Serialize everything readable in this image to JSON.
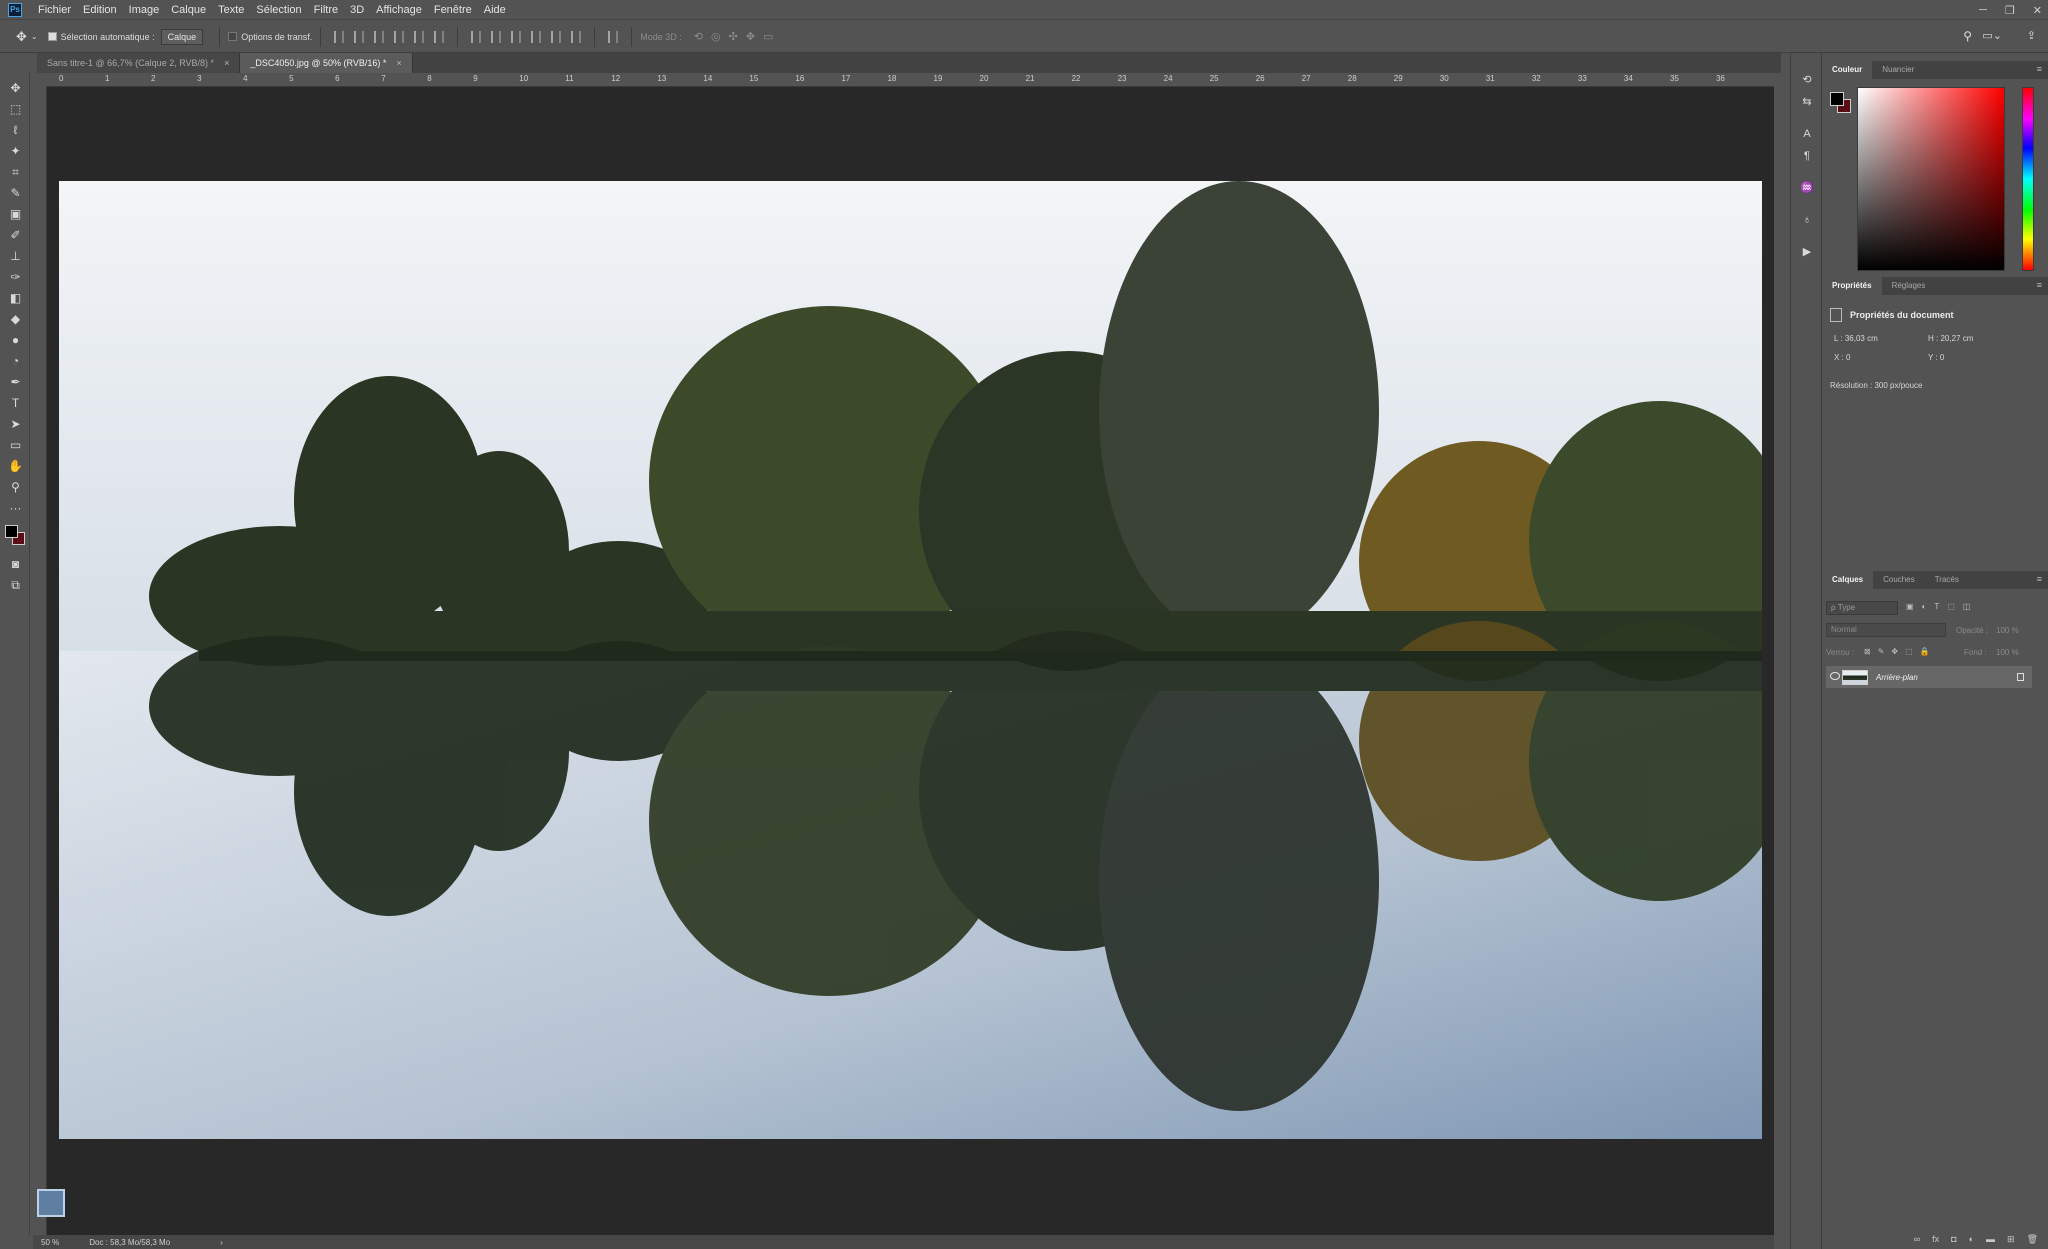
{
  "app": {
    "logo": "Ps"
  },
  "menu": [
    "Fichier",
    "Edition",
    "Image",
    "Calque",
    "Texte",
    "Sélection",
    "Filtre",
    "3D",
    "Affichage",
    "Fenêtre",
    "Aide"
  ],
  "options": {
    "auto_select_label": "Sélection automatique :",
    "auto_select_value": "Calque",
    "transform_label": "Options de transf.",
    "mode3d_label": "Mode 3D :"
  },
  "tabs": [
    {
      "label": "Sans titre-1 @ 66,7% (Calque 2, RVB/8) *",
      "close": "×"
    },
    {
      "label": "_DSC4050.jpg @ 50% (RVB/16) *",
      "close": "×"
    }
  ],
  "ruler": {
    "h_ticks": [
      "0",
      "1",
      "2",
      "3",
      "4",
      "5",
      "6",
      "7",
      "8",
      "9",
      "10",
      "11",
      "12",
      "13",
      "14",
      "15",
      "16",
      "17",
      "18",
      "19",
      "20",
      "21",
      "22",
      "23",
      "24",
      "25",
      "26",
      "27",
      "28",
      "29",
      "30",
      "31",
      "32",
      "33",
      "34",
      "35",
      "36"
    ]
  },
  "status": {
    "zoom": "50 %",
    "doc": "Doc : 58,3 Mo/58,3 Mo",
    "arrow": "›"
  },
  "color_panel": {
    "tabs": [
      "Couleur",
      "Nuancier"
    ],
    "fg": "#000000",
    "bg": "#5a0d14",
    "menu": "≡"
  },
  "properties_panel": {
    "tabs": [
      "Propriétés",
      "Réglages"
    ],
    "menu": "≡",
    "header": "Propriétés du document",
    "L": "L :  36,03 cm",
    "H": "H :  20,27 cm",
    "X": "X :  0",
    "Y": "Y :  0",
    "resolution": "Résolution : 300 px/pouce"
  },
  "layers_panel": {
    "tabs": [
      "Calques",
      "Couches",
      "Tracés"
    ],
    "menu": "≡",
    "search_placeholder": "ρ Type",
    "blend_mode": "Normal",
    "opacity_label": "Opacité :",
    "opacity_value": "100 %",
    "lock_label": "Verrou :",
    "fill_label": "Fond :",
    "fill_value": "100 %",
    "layer_name": "Arrière-plan",
    "footer_icons": [
      "∞",
      "fx",
      "◘",
      "◐",
      "▬",
      "⊞",
      "🗑"
    ]
  }
}
